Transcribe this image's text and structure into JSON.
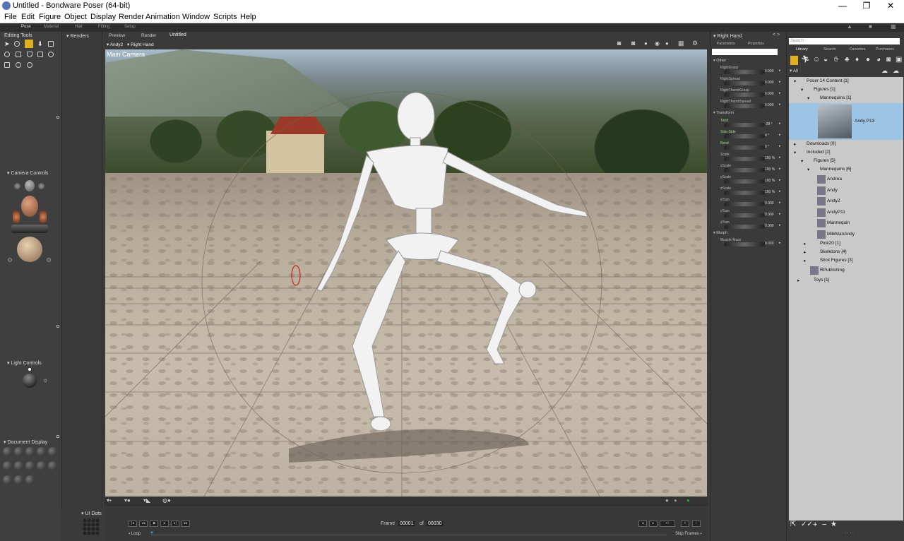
{
  "window": {
    "title": "Untitled - Bondware Poser (64-bit)",
    "minimize": "—",
    "maximize": "❐",
    "close": "✕"
  },
  "menu": [
    "File",
    "Edit",
    "Figure",
    "Object",
    "Display",
    "Render",
    "Animation",
    "Window",
    "Scripts",
    "Help"
  ],
  "rooms": [
    "Pose",
    "Material",
    "Hair",
    "Fitting",
    "Setup"
  ],
  "left_panel": {
    "editing_tools": "Editing Tools",
    "camera_controls": "Camera Controls",
    "light_controls": "Light Controls",
    "document_display": "Document  Display",
    "ui_dots": "UI Dots"
  },
  "renders_panel": {
    "label": "Renders"
  },
  "viewport": {
    "tabs": [
      "Preview",
      "Render",
      "Untitled"
    ],
    "figure_select": "Andy2",
    "actor_select": "Right Hand",
    "camera_label": "Main Camera"
  },
  "params_panel": {
    "title": "Right Hand",
    "tabs": [
      "Parameters",
      "Properties"
    ],
    "sections": {
      "other": "Other",
      "transform": "Transform",
      "morph": "Morph"
    },
    "other_params": [
      {
        "name": "RightGrasp",
        "value": "0.000"
      },
      {
        "name": "RightSpread",
        "value": "0.000"
      },
      {
        "name": "RightThumbGrasp",
        "value": "0.000"
      },
      {
        "name": "RightThumbSpread",
        "value": "0.000"
      }
    ],
    "transform_params": [
      {
        "name": "Twist",
        "value": "-28 °"
      },
      {
        "name": "Side-Side",
        "value": "4 °"
      },
      {
        "name": "Bend",
        "value": "0 °"
      },
      {
        "name": "Scale",
        "value": "100 %"
      },
      {
        "name": "xScale",
        "value": "100 %"
      },
      {
        "name": "yScale",
        "value": "100 %"
      },
      {
        "name": "zScale",
        "value": "100 %"
      },
      {
        "name": "xTran",
        "value": "0.000"
      },
      {
        "name": "yTran",
        "value": "0.000"
      },
      {
        "name": "zTran",
        "value": "0.000"
      }
    ],
    "morph_params": [
      {
        "name": "Muscle Mass",
        "value": "0.000"
      }
    ]
  },
  "library": {
    "search_placeholder": "Search",
    "tabs": [
      "Library",
      "Search",
      "Favorites",
      "Purchases"
    ],
    "filter": "All",
    "tree": [
      {
        "label": "Poser 14 Content [1]",
        "indent": 0
      },
      {
        "label": "Figures [1]",
        "indent": 1
      },
      {
        "label": "Mannequins [1]",
        "indent": 2
      },
      {
        "label": "Downloads [0]",
        "indent": 0
      },
      {
        "label": "Included [2]",
        "indent": 0
      },
      {
        "label": "Figures [5]",
        "indent": 1
      },
      {
        "label": "Mannequins [6]",
        "indent": 2
      }
    ],
    "selected_item": "Andy P13",
    "mannequins": [
      "Andrea",
      "Andy",
      "Andy2",
      "AndyP11",
      "Mannequin",
      "MilkManAndy"
    ],
    "more_folders": [
      "Pink20 [1]",
      "Skeletons [4]",
      "Stick Figures [3]"
    ],
    "rpublishing": "RPublishing",
    "toys": "Toys [1]"
  },
  "timeline": {
    "frame_label": "Frame",
    "frame_current": "00001",
    "of_label": "of",
    "frame_total": "00030",
    "loop": "Loop",
    "skip_frames": "Skip Frames"
  }
}
